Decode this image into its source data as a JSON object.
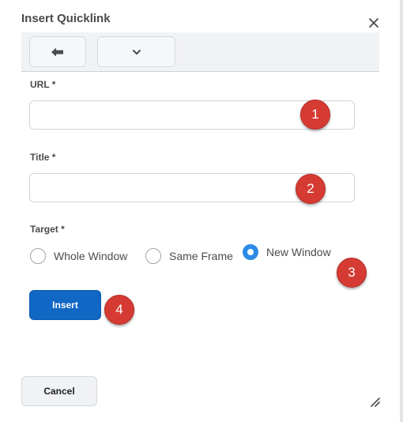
{
  "dialog": {
    "title": "Insert Quicklink",
    "close_icon": "close-icon"
  },
  "toolbar": {
    "back_icon": "back-arrow-icon",
    "more_icon": "chevron-down-icon"
  },
  "form": {
    "url_label": "URL *",
    "url_value": "",
    "title_label": "Title *",
    "title_value": "",
    "target_label": "Target *",
    "target_options": [
      {
        "label": "Whole Window",
        "checked": false
      },
      {
        "label": "Same Frame",
        "checked": false
      },
      {
        "label": "New Window",
        "checked": true
      }
    ],
    "insert_label": "Insert"
  },
  "footer": {
    "cancel_label": "Cancel",
    "resize_icon": "resize-handle-icon"
  },
  "annotations": [
    "1",
    "2",
    "3",
    "4"
  ],
  "colors": {
    "primary": "#1167c4",
    "radio_checked": "#2d8ae5",
    "badge": "#d63b33"
  }
}
